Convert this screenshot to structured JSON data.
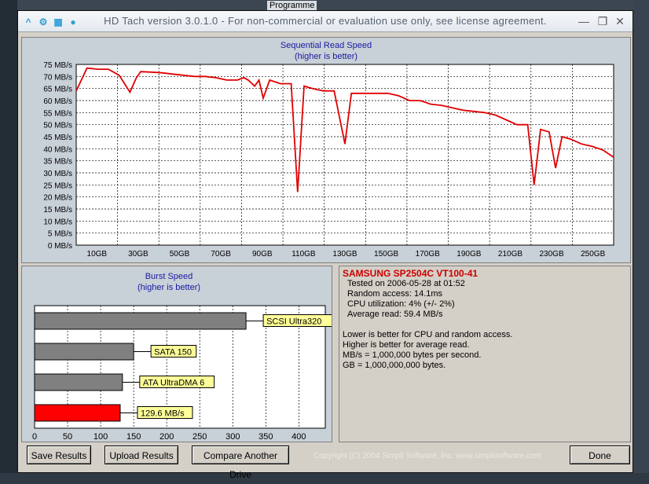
{
  "desktop": {
    "bg_item_label": "Programme"
  },
  "window": {
    "title": "HD Tach version 3.0.1.0  - For non-commercial or evaluation use only, see license agreement."
  },
  "read_chart_title": [
    "Sequential Read Speed",
    "(higher is better)"
  ],
  "burst_chart_title": [
    "Burst Speed",
    "(higher is better)"
  ],
  "chart_data": [
    {
      "type": "line",
      "title": "Sequential Read Speed",
      "subtitle": "(higher is better)",
      "y_unit": "MB/s",
      "ylim": [
        0,
        75
      ],
      "xlim": [
        0,
        250
      ],
      "yticks": [
        "0 MB/s",
        "5 MB/s",
        "10 MB/s",
        "15 MB/s",
        "20 MB/s",
        "25 MB/s",
        "30 MB/s",
        "35 MB/s",
        "40 MB/s",
        "45 MB/s",
        "50 MB/s",
        "55 MB/s",
        "60 MB/s",
        "65 MB/s",
        "70 MB/s",
        "75 MB/s"
      ],
      "xticks": [
        "10GB",
        "30GB",
        "50GB",
        "70GB",
        "90GB",
        "110GB",
        "130GB",
        "150GB",
        "170GB",
        "190GB",
        "210GB",
        "230GB",
        "250GB"
      ],
      "grid": true,
      "series": [
        {
          "color": "#e00000",
          "x": [
            0,
            5,
            10,
            15,
            20,
            25,
            28,
            30,
            35,
            40,
            45,
            50,
            55,
            60,
            65,
            70,
            72,
            75,
            78,
            80,
            83,
            85,
            87,
            90,
            95,
            100,
            103,
            106,
            110,
            115,
            120,
            125,
            128,
            131,
            135,
            140,
            145,
            150,
            155,
            160,
            165,
            170,
            175,
            180,
            185,
            190,
            195,
            200,
            205,
            210,
            213,
            216,
            220,
            223,
            226,
            230,
            235,
            240,
            245,
            250
          ],
          "y": [
            64,
            73.5,
            73,
            73,
            70.5,
            63.5,
            69.5,
            72,
            71.8,
            71.5,
            71,
            70.5,
            70,
            70,
            69.5,
            68.5,
            68.5,
            68.5,
            69.5,
            68.5,
            66,
            68.5,
            61,
            68.5,
            67,
            67,
            22,
            66,
            65,
            64,
            64,
            42,
            63,
            63,
            63,
            63,
            63,
            62,
            60,
            60,
            58.5,
            58,
            57,
            56,
            55.5,
            55,
            54,
            52,
            50,
            50,
            25,
            48,
            47,
            32,
            45,
            44,
            42,
            41,
            39.5,
            36.5
          ]
        }
      ]
    },
    {
      "type": "bar",
      "title": "Burst Speed",
      "subtitle": "(higher is better)",
      "orientation": "horizontal",
      "xlim": [
        0,
        440
      ],
      "xticks": [
        "0",
        "50",
        "100",
        "150",
        "200",
        "250",
        "300",
        "350",
        "400"
      ],
      "categories": [
        "SCSI Ultra320",
        "SATA 150",
        "ATA UltraDMA 6",
        "129.6 MB/s"
      ],
      "values": [
        320,
        150,
        133,
        129.6
      ],
      "colors": [
        "#808080",
        "#808080",
        "#808080",
        "#ff0000"
      ],
      "label_bg": "#ffff99"
    }
  ],
  "info": {
    "drive_name": "SAMSUNG SP2504C VT100-41",
    "lines": [
      "Tested on 2006-05-28 at 01:52",
      "Random access: 14.1ms",
      "CPU utilization: 4% (+/- 2%)",
      "Average read: 59.4 MB/s"
    ],
    "notes": [
      "Lower is better for CPU and random access.",
      "Higher is better for average read.",
      "MB/s = 1,000,000 bytes per second.",
      "GB = 1,000,000,000 bytes."
    ]
  },
  "buttons": {
    "save": "Save Results",
    "upload": "Upload Results",
    "compare": "Compare Another Drive",
    "done": "Done"
  },
  "copyright": "Copyright (C) 2004 Simpli Software, Inc. www.simplisoftware.com"
}
